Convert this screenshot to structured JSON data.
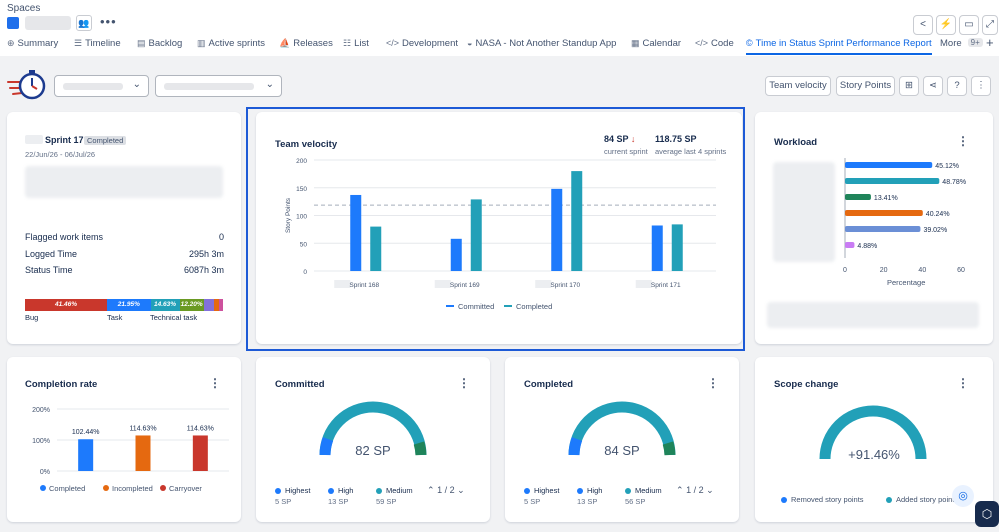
{
  "header": {
    "spaces_label": "Spaces"
  },
  "tabs": [
    {
      "label": "Summary",
      "icon": "globe-icon"
    },
    {
      "label": "Timeline",
      "icon": "timeline-icon"
    },
    {
      "label": "Backlog",
      "icon": "backlog-icon"
    },
    {
      "label": "Active sprints",
      "icon": "board-icon"
    },
    {
      "label": "Releases",
      "icon": "ship-icon"
    },
    {
      "label": "List",
      "icon": "list-icon"
    },
    {
      "label": "Development",
      "icon": "code-icon"
    },
    {
      "label": "NASA - Not Another Standup App",
      "icon": "app-icon"
    },
    {
      "label": "Calendar",
      "icon": "calendar-icon"
    },
    {
      "label": "Code",
      "icon": "code-icon"
    },
    {
      "label": "Time in Status Sprint Performance Report",
      "icon": "copyright-icon",
      "active": true
    },
    {
      "label": "More",
      "badge": "9+"
    }
  ],
  "toolbar": {
    "team_velocity_btn": "Team velocity",
    "story_points_btn": "Story Points"
  },
  "sprint_card": {
    "sprint_name": "Sprint 171",
    "status_badge": "Completed",
    "dates": "22/Jun/26 - 06/Jul/26",
    "stats": [
      {
        "label": "Flagged work items",
        "value": "0"
      },
      {
        "label": "Logged Time",
        "value": "295h 3m"
      },
      {
        "label": "Status Time",
        "value": "6087h 3m"
      }
    ],
    "bar_segments": [
      {
        "label": "41.46%",
        "fraction": 0.4146,
        "color": "#c9372c"
      },
      {
        "label": "21.95%",
        "fraction": 0.2195,
        "color": "#1d7afc"
      },
      {
        "label": "14.63%",
        "fraction": 0.1463,
        "color": "#22a0b8"
      },
      {
        "label": "12.20%",
        "fraction": 0.122,
        "color": "#6a9a23"
      },
      {
        "label": "",
        "fraction": 0.05,
        "color": "#8270db"
      },
      {
        "label": "",
        "fraction": 0.025,
        "color": "#e56910"
      },
      {
        "label": "",
        "fraction": 0.0226,
        "color": "#cd519d"
      }
    ],
    "bar_legend": [
      "Bug",
      "Task",
      "Technical task"
    ]
  },
  "velocity_card": {
    "title": "Team velocity",
    "current_sp": "84 SP",
    "current_label": "current sprint",
    "avg_sp": "118.75 SP",
    "avg_label": "average last 4 sprints"
  },
  "workload_card": {
    "title": "Workload",
    "xlabel": "Percentage"
  },
  "completion_card": {
    "title": "Completion rate"
  },
  "committed_card": {
    "title": "Committed",
    "value": "82 SP",
    "legend": [
      {
        "name": "Highest",
        "sub": "5 SP",
        "color": "#1d7afc"
      },
      {
        "name": "High",
        "sub": "13 SP",
        "color": "#1d7afc"
      },
      {
        "name": "Medium",
        "sub": "59 SP",
        "color": "#22a0b8"
      }
    ],
    "pager": "1 / 2"
  },
  "completed_card": {
    "title": "Completed",
    "value": "84 SP",
    "legend": [
      {
        "name": "Highest",
        "sub": "5 SP",
        "color": "#1d7afc"
      },
      {
        "name": "High",
        "sub": "13 SP",
        "color": "#1d7afc"
      },
      {
        "name": "Medium",
        "sub": "56 SP",
        "color": "#22a0b8"
      }
    ],
    "pager": "1 / 2"
  },
  "scope_card": {
    "title": "Scope change",
    "value": "+91.46%",
    "legend_removed": "Removed story points",
    "legend_added": "Added story points"
  },
  "colors": {
    "accent": "#0c66e4",
    "committed": "#1d7afc",
    "completed": "#22a0b8",
    "incompleted": "#e56910",
    "carryover": "#c9372c",
    "selection": "#1d5ad6"
  },
  "chart_data": [
    {
      "type": "bar",
      "title": "Team velocity",
      "ylabel": "Story Points",
      "categories": [
        "Sprint 168",
        "Sprint 169",
        "Sprint 170",
        "Sprint 171"
      ],
      "series": [
        {
          "name": "Committed",
          "values": [
            137,
            58,
            148,
            82
          ],
          "color": "#1d7afc"
        },
        {
          "name": "Completed",
          "values": [
            80,
            129,
            180,
            84
          ],
          "color": "#22a0b8"
        }
      ],
      "reference_line": 118.75,
      "ylim": [
        0,
        200
      ],
      "yticks": [
        0,
        50,
        100,
        150,
        200
      ]
    },
    {
      "type": "bar",
      "orientation": "horizontal",
      "title": "Workload",
      "xlabel": "Percentage",
      "values": [
        45.12,
        48.78,
        13.41,
        40.24,
        39.02,
        4.88
      ],
      "labels": [
        "45.12%",
        "48.78%",
        "13.41%",
        "40.24%",
        "39.02%",
        "4.88%"
      ],
      "colors": [
        "#1d7afc",
        "#22a0b8",
        "#1f845a",
        "#e56910",
        "#6b8fd6",
        "#c97cf4"
      ],
      "xlim": [
        0,
        60
      ],
      "xticks": [
        0,
        20,
        40,
        60
      ]
    },
    {
      "type": "bar",
      "title": "Completion rate",
      "categories": [
        "Completed",
        "Incompleted",
        "Carryover"
      ],
      "values": [
        102.44,
        114.63,
        114.63
      ],
      "labels": [
        "102.44%",
        "114.63%",
        "114.63%"
      ],
      "colors": [
        "#1d7afc",
        "#e56910",
        "#c9372c"
      ],
      "ylim": [
        0,
        200
      ],
      "yticks": [
        "0%",
        "100%",
        "200%"
      ]
    }
  ]
}
